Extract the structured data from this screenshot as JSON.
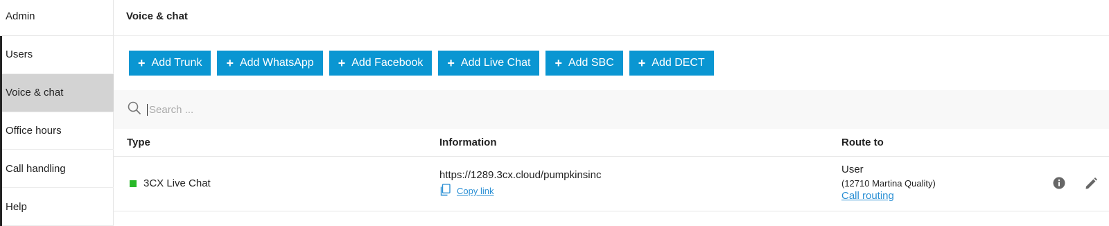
{
  "sidebar": {
    "title": "Admin",
    "items": [
      {
        "label": "Users"
      },
      {
        "label": "Voice & chat"
      },
      {
        "label": "Office hours"
      },
      {
        "label": "Call handling"
      },
      {
        "label": "Help"
      }
    ],
    "active_item": "Voice & chat"
  },
  "main": {
    "title": "Voice & chat",
    "buttons": [
      {
        "label": "Add Trunk"
      },
      {
        "label": "Add WhatsApp"
      },
      {
        "label": "Add Facebook"
      },
      {
        "label": "Add Live Chat"
      },
      {
        "label": "Add SBC"
      },
      {
        "label": "Add DECT"
      }
    ],
    "search": {
      "placeholder": "Search ...",
      "value": ""
    },
    "table": {
      "columns": [
        "Type",
        "Information",
        "Route to"
      ],
      "rows": [
        {
          "type": "3CX Live Chat",
          "status_color": "#28b828",
          "info_url": "https://1289.3cx.cloud/pumpkinsinc",
          "copy_label": "Copy link",
          "route_type": "User",
          "route_detail": "(12710 Martina Quality)",
          "route_link": "Call routing"
        }
      ]
    }
  },
  "colors": {
    "accent": "#0a96d2",
    "link": "#2a8fd4",
    "active_bg": "#d3d3d3"
  },
  "icons": [
    "plus-icon",
    "search-icon",
    "copy-icon",
    "info-icon",
    "edit-icon"
  ]
}
